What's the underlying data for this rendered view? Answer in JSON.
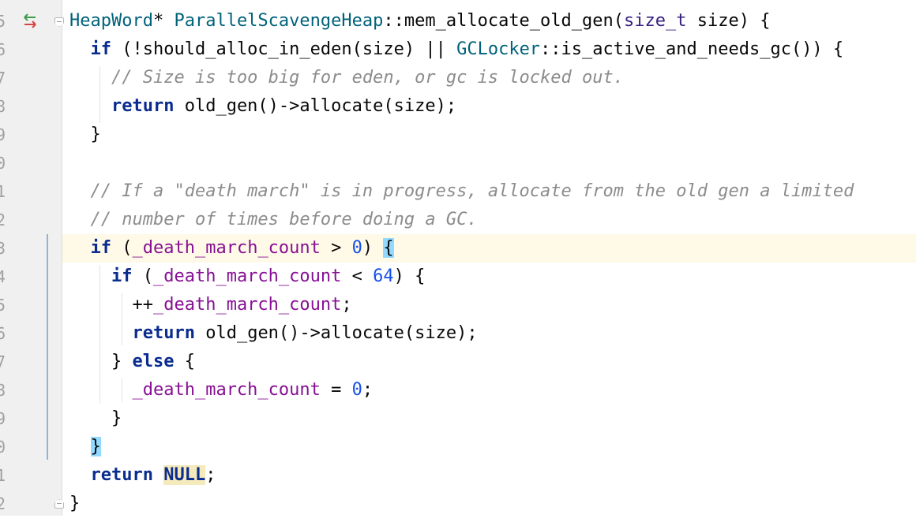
{
  "editor": {
    "line_numbers": [
      "5",
      "6",
      "7",
      "8",
      "9",
      "0",
      "1",
      "2",
      "3",
      "4",
      "5",
      "6",
      "7",
      "8",
      "9",
      "0",
      "1",
      "2"
    ],
    "gutter_icon": "override-arrows-icon",
    "colors": {
      "keyword": "#0b2c8f",
      "type": "#00627a",
      "field": "#871094",
      "number": "#1750eb",
      "comment": "#8c8c8c",
      "current_line": "#fefae7",
      "brace_match": "#93d9ff",
      "highlight": "#f5eabb"
    },
    "code": {
      "l1": {
        "t1": "HeapWord",
        "t2": "* ",
        "t3": "ParallelScavengeHeap",
        "t4": "::mem_allocate_old_gen(",
        "t5": "size_t",
        "t6": " size) {"
      },
      "l2": {
        "t1": "if",
        "t2": " (!should_alloc_in_eden(size) || ",
        "t3": "GCLocker",
        "t4": "::is_active_and_needs_gc()) {"
      },
      "l3": {
        "t1": "// Size is too big for eden, or gc is locked out."
      },
      "l4": {
        "t1": "return",
        "t2": " old_gen()->allocate(size);"
      },
      "l5": {
        "t1": "}"
      },
      "l7": {
        "t1": "// If a \"death march\" is in progress, allocate from the old gen a limited"
      },
      "l8": {
        "t1": "// number of times before doing a GC."
      },
      "l9": {
        "t1": "if",
        "t2": " (",
        "t3": "_death_march_count",
        "t4": " > ",
        "t5": "0",
        "t6": ") ",
        "t7": "{"
      },
      "l10": {
        "t1": "if",
        "t2": " (",
        "t3": "_death_march_count",
        "t4": " < ",
        "t5": "64",
        "t6": ") {"
      },
      "l11": {
        "t1": "++",
        "t2": "_death_march_count",
        "t3": ";"
      },
      "l12": {
        "t1": "return",
        "t2": " old_gen()->allocate(size);"
      },
      "l13": {
        "t1": "} ",
        "t2": "else",
        "t3": " {"
      },
      "l14": {
        "t1": "_death_march_count",
        "t2": " = ",
        "t3": "0",
        "t4": ";"
      },
      "l15": {
        "t1": "}"
      },
      "l16": {
        "t1": "}"
      },
      "l17": {
        "t1": "return",
        "t2": " ",
        "t3": "NULL",
        "t4": ";"
      },
      "l18": {
        "t1": "}"
      }
    }
  }
}
